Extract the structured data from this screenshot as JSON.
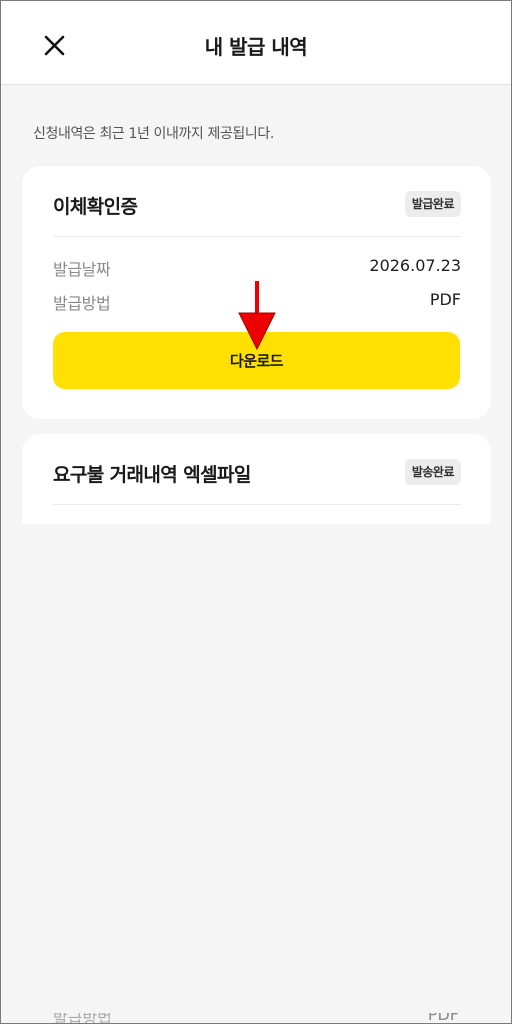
{
  "header": {
    "title": "내 발급 내역",
    "close_icon": "close-icon"
  },
  "notice": "신청내역은 최근 1년 이내까지 제공됩니다.",
  "cards": [
    {
      "title": "이체확인증",
      "status": "발급완료",
      "rows": [
        {
          "label": "발급날짜",
          "value": "2026.07.23"
        },
        {
          "label": "발급방법",
          "value": "PDF"
        }
      ],
      "button_label": "다운로드"
    },
    {
      "title": "요구불 거래내역 엑셀파일",
      "status": "발송완료"
    }
  ],
  "footer_partial": {
    "label": "발급방법",
    "value": "PDF"
  },
  "colors": {
    "accent": "#ffe000",
    "arrow": "#ee0000",
    "background": "#f5f5f5"
  }
}
